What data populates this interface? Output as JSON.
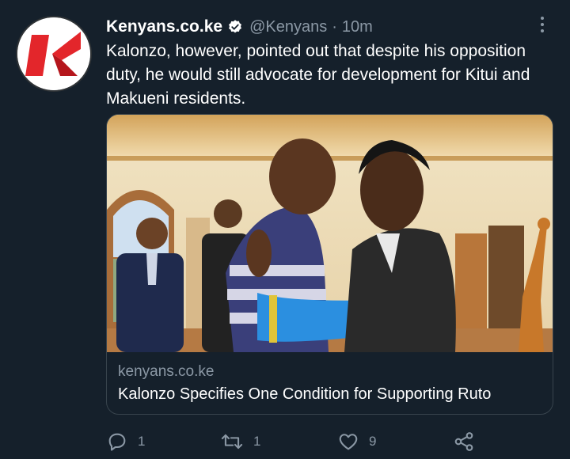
{
  "tweet": {
    "author_name": "Kenyans.co.ke",
    "handle": "@Kenyans",
    "separator": "·",
    "time": "10m",
    "text": "Kalonzo, however, pointed out that despite his opposition duty, he would still advocate for development for Kitui and Makueni residents.",
    "avatar_icon": "kenyans-logo-icon",
    "verified_icon": "verified-badge-icon",
    "more_icon": "more-vertical-icon"
  },
  "card": {
    "domain": "kenyans.co.ke",
    "title": "Kalonzo Specifies One Condition for Supporting Ruto",
    "image": "photo-two-men-embracing"
  },
  "actions": {
    "reply": {
      "icon": "reply-icon",
      "count": "1"
    },
    "retweet": {
      "icon": "retweet-icon",
      "count": "1"
    },
    "like": {
      "icon": "heart-icon",
      "count": "9"
    },
    "share": {
      "icon": "share-icon",
      "count": ""
    }
  },
  "colors": {
    "background": "#15202b",
    "secondary_text": "#8b98a5",
    "card_border": "#38444d",
    "brand_red": "#e3262b"
  }
}
